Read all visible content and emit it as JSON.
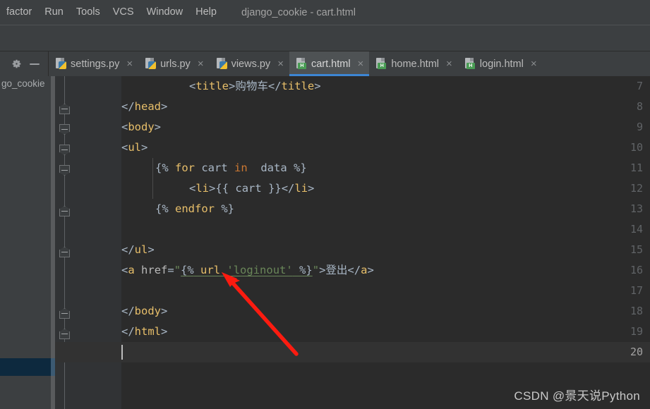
{
  "window": {
    "project_title": "django_cookie - cart.html"
  },
  "menubar": {
    "items": [
      {
        "label": "factor",
        "mnemonic": ""
      },
      {
        "label": "Run",
        "mnemonic": "u"
      },
      {
        "label": "Tools",
        "mnemonic": "T"
      },
      {
        "label": "VCS",
        "mnemonic": "S"
      },
      {
        "label": "Window",
        "mnemonic": "W"
      },
      {
        "label": "Help",
        "mnemonic": "H"
      }
    ]
  },
  "toolbar": {
    "gear_icon": "gear-icon",
    "minimize_icon": "minimize-icon"
  },
  "tabs": [
    {
      "label": "settings.py",
      "icon": "python-file-icon",
      "active": false
    },
    {
      "label": "urls.py",
      "icon": "python-file-icon",
      "active": false
    },
    {
      "label": "views.py",
      "icon": "python-file-icon",
      "active": false
    },
    {
      "label": "cart.html",
      "icon": "html-file-icon",
      "active": true
    },
    {
      "label": "home.html",
      "icon": "html-file-icon",
      "active": false
    },
    {
      "label": "login.html",
      "icon": "html-file-icon",
      "active": false
    }
  ],
  "tab_close_glyph": "×",
  "html_badge": "H",
  "sidebar": {
    "items": [
      {
        "label": "go_cookie",
        "selected": false
      }
    ]
  },
  "editor": {
    "file": "cart.html",
    "current_line": 20,
    "lines": [
      {
        "no": "7",
        "indent": 4,
        "text": "<title>购物车</title>"
      },
      {
        "no": "8",
        "indent": 0,
        "text": "</head>"
      },
      {
        "no": "9",
        "indent": 0,
        "text": "<body>"
      },
      {
        "no": "10",
        "indent": 0,
        "text": "<ul>"
      },
      {
        "no": "11",
        "indent": 4,
        "text": "{% for cart in  data %}"
      },
      {
        "no": "12",
        "indent": 8,
        "text": "<li>{{ cart }}</li>"
      },
      {
        "no": "13",
        "indent": 4,
        "text": "{% endfor %}"
      },
      {
        "no": "14",
        "indent": 0,
        "text": ""
      },
      {
        "no": "15",
        "indent": 0,
        "text": "</ul>"
      },
      {
        "no": "16",
        "indent": 0,
        "text": "<a href=\"{% url 'loginout' %}\">登出</a>"
      },
      {
        "no": "17",
        "indent": 0,
        "text": ""
      },
      {
        "no": "18",
        "indent": 0,
        "text": "</body>"
      },
      {
        "no": "19",
        "indent": 0,
        "text": "</html>"
      },
      {
        "no": "20",
        "indent": 0,
        "text": ""
      }
    ]
  },
  "annotation": {
    "arrow_color": "#fb1b10",
    "arrow_from": "420,502",
    "arrow_to": "316,388"
  },
  "watermark": {
    "text": "CSDN @景天说Python"
  },
  "colors": {
    "editor_bg": "#2b2b2b",
    "gutter_bg": "#313335",
    "chrome_bg": "#3c3f41",
    "tab_active_bg": "#4e5254",
    "tab_active_underline": "#3d86d4",
    "tag": "#e8bf6a",
    "string": "#6a8759",
    "keyword": "#cc7832",
    "text": "#a9b7c6",
    "sidebar_selection": "#0d293e"
  }
}
